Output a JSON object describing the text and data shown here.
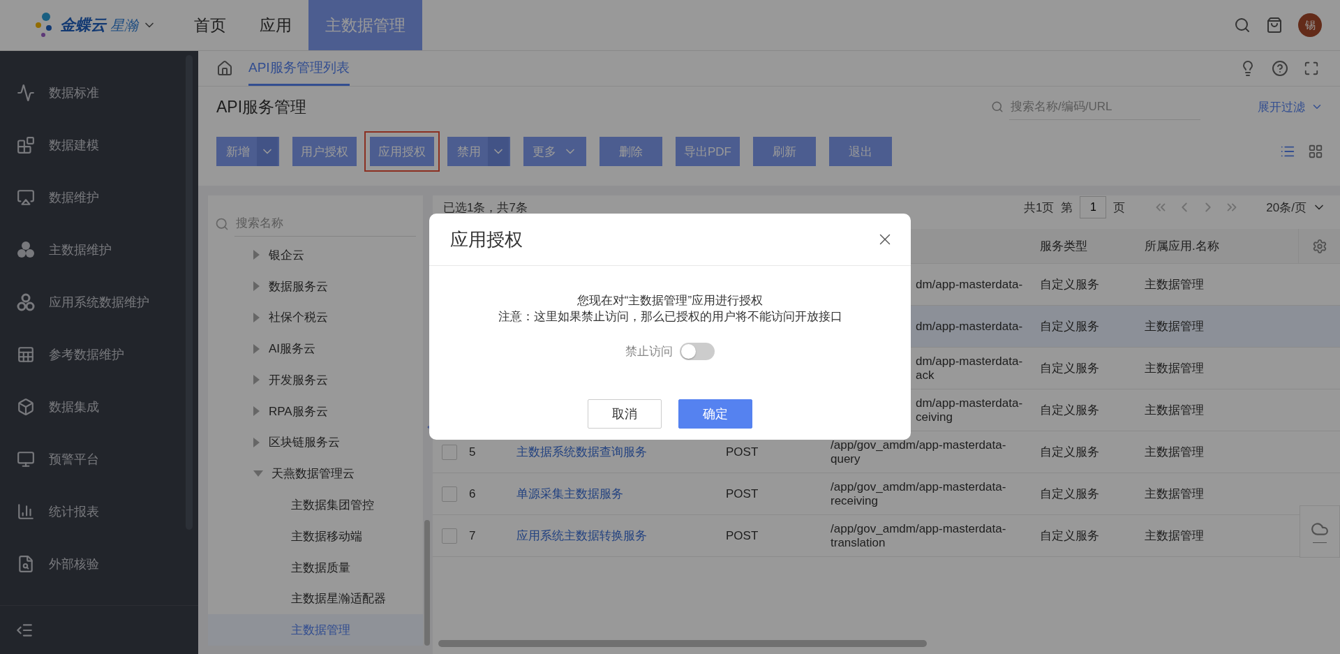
{
  "topbar": {
    "logo": {
      "brand": "金蝶云",
      "product": "星瀚"
    },
    "nav": [
      {
        "label": "首页",
        "selected": false
      },
      {
        "label": "应用",
        "selected": false
      },
      {
        "label": "主数据管理",
        "selected": true
      }
    ],
    "avatar": "锡"
  },
  "sidebar": {
    "items": [
      {
        "label": "数据标准"
      },
      {
        "label": "数据建模"
      },
      {
        "label": "数据维护"
      },
      {
        "label": "主数据维护"
      },
      {
        "label": "应用系统数据维护"
      },
      {
        "label": "参考数据维护"
      },
      {
        "label": "数据集成"
      },
      {
        "label": "预警平台"
      },
      {
        "label": "统计报表"
      },
      {
        "label": "外部核验"
      }
    ]
  },
  "breadcrumb": {
    "tabs": [
      {
        "label": "API服务管理列表",
        "selected": true
      }
    ]
  },
  "page": {
    "title": "API服务管理",
    "search": {
      "placeholder": "搜索名称/编码/URL"
    },
    "filter_link": "展开过滤"
  },
  "toolbar": [
    {
      "label": "新增",
      "kind": "split",
      "outlined": false
    },
    {
      "label": "用户授权",
      "kind": "plain",
      "outlined": false
    },
    {
      "label": "应用授权",
      "kind": "plain",
      "outlined": true
    },
    {
      "label": "禁用",
      "kind": "split",
      "outlined": false
    },
    {
      "label": "更多",
      "kind": "menu",
      "outlined": false
    },
    {
      "label": "删除",
      "kind": "plain",
      "outlined": false
    },
    {
      "label": "导出PDF",
      "kind": "plain",
      "outlined": false
    },
    {
      "label": "刷新",
      "kind": "plain",
      "outlined": false
    },
    {
      "label": "退出",
      "kind": "plain",
      "outlined": false
    }
  ],
  "tree": {
    "search": {
      "placeholder": "搜索名称"
    },
    "items": [
      {
        "label": "银企云",
        "expanded": false,
        "selected": false
      },
      {
        "label": "数据服务云",
        "expanded": false,
        "selected": false
      },
      {
        "label": "社保个税云",
        "expanded": false,
        "selected": false
      },
      {
        "label": "AI服务云",
        "expanded": false,
        "selected": false
      },
      {
        "label": "开发服务云",
        "expanded": false,
        "selected": false
      },
      {
        "label": "RPA服务云",
        "expanded": false,
        "selected": false
      },
      {
        "label": "区块链服务云",
        "expanded": false,
        "selected": false
      },
      {
        "label": "天燕数据管理云",
        "expanded": true,
        "selected": false,
        "children": [
          {
            "label": "主数据集团管控",
            "selected": false
          },
          {
            "label": "主数据移动端",
            "selected": false
          },
          {
            "label": "主数据质量",
            "selected": false
          },
          {
            "label": "主数据星瀚适配器",
            "selected": false
          },
          {
            "label": "主数据管理",
            "selected": true
          }
        ]
      }
    ]
  },
  "table": {
    "summary": "已选1条，共7条",
    "pagination": {
      "total_pages": "共1页",
      "page_prefix": "第",
      "page": "1",
      "page_suffix": "页",
      "page_size": "20条/页"
    },
    "columns": [
      "服务类型",
      "所属应用.名称"
    ],
    "rows": [
      {
        "selected": false,
        "url": [
          "dm/app-masterdata-"
        ],
        "type": "自定义服务",
        "app": "主数据管理"
      },
      {
        "selected": true,
        "url": [
          "dm/app-masterdata-"
        ],
        "type": "自定义服务",
        "app": "主数据管理"
      },
      {
        "selected": false,
        "url": [
          "dm/app-masterdata-",
          "ack"
        ],
        "type": "自定义服务",
        "app": "主数据管理"
      },
      {
        "selected": false,
        "url": [
          "dm/app-masterdata-",
          "ceiving"
        ],
        "type": "自定义服务",
        "app": "主数据管理"
      },
      {
        "selected": false,
        "number": "5",
        "name": "主数据系统数据查询服务",
        "method": "POST",
        "url": [
          "/app/gov_amdm/app-masterdata-",
          "query"
        ],
        "type": "自定义服务",
        "app": "主数据管理"
      },
      {
        "selected": false,
        "number": "6",
        "name": "单源采集主数据服务",
        "method": "POST",
        "url": [
          "/app/gov_amdm/app-masterdata-",
          "receiving"
        ],
        "type": "自定义服务",
        "app": "主数据管理"
      },
      {
        "selected": false,
        "number": "7",
        "name": "应用系统主数据转换服务",
        "method": "POST",
        "url": [
          "/app/gov_amdm/app-masterdata-",
          "translation"
        ],
        "type": "自定义服务",
        "app": "主数据管理"
      }
    ]
  },
  "dialog": {
    "title": "应用授权",
    "message": "您现在对“主数据管理”应用进行授权",
    "note": "注意：这里如果禁止访问，那么已授权的用户将不能访问开放接口",
    "toggle": {
      "label": "禁止访问",
      "on": false
    },
    "buttons": [
      {
        "label": "取消",
        "kind": "secondary"
      },
      {
        "label": "确定",
        "kind": "primary"
      }
    ]
  }
}
